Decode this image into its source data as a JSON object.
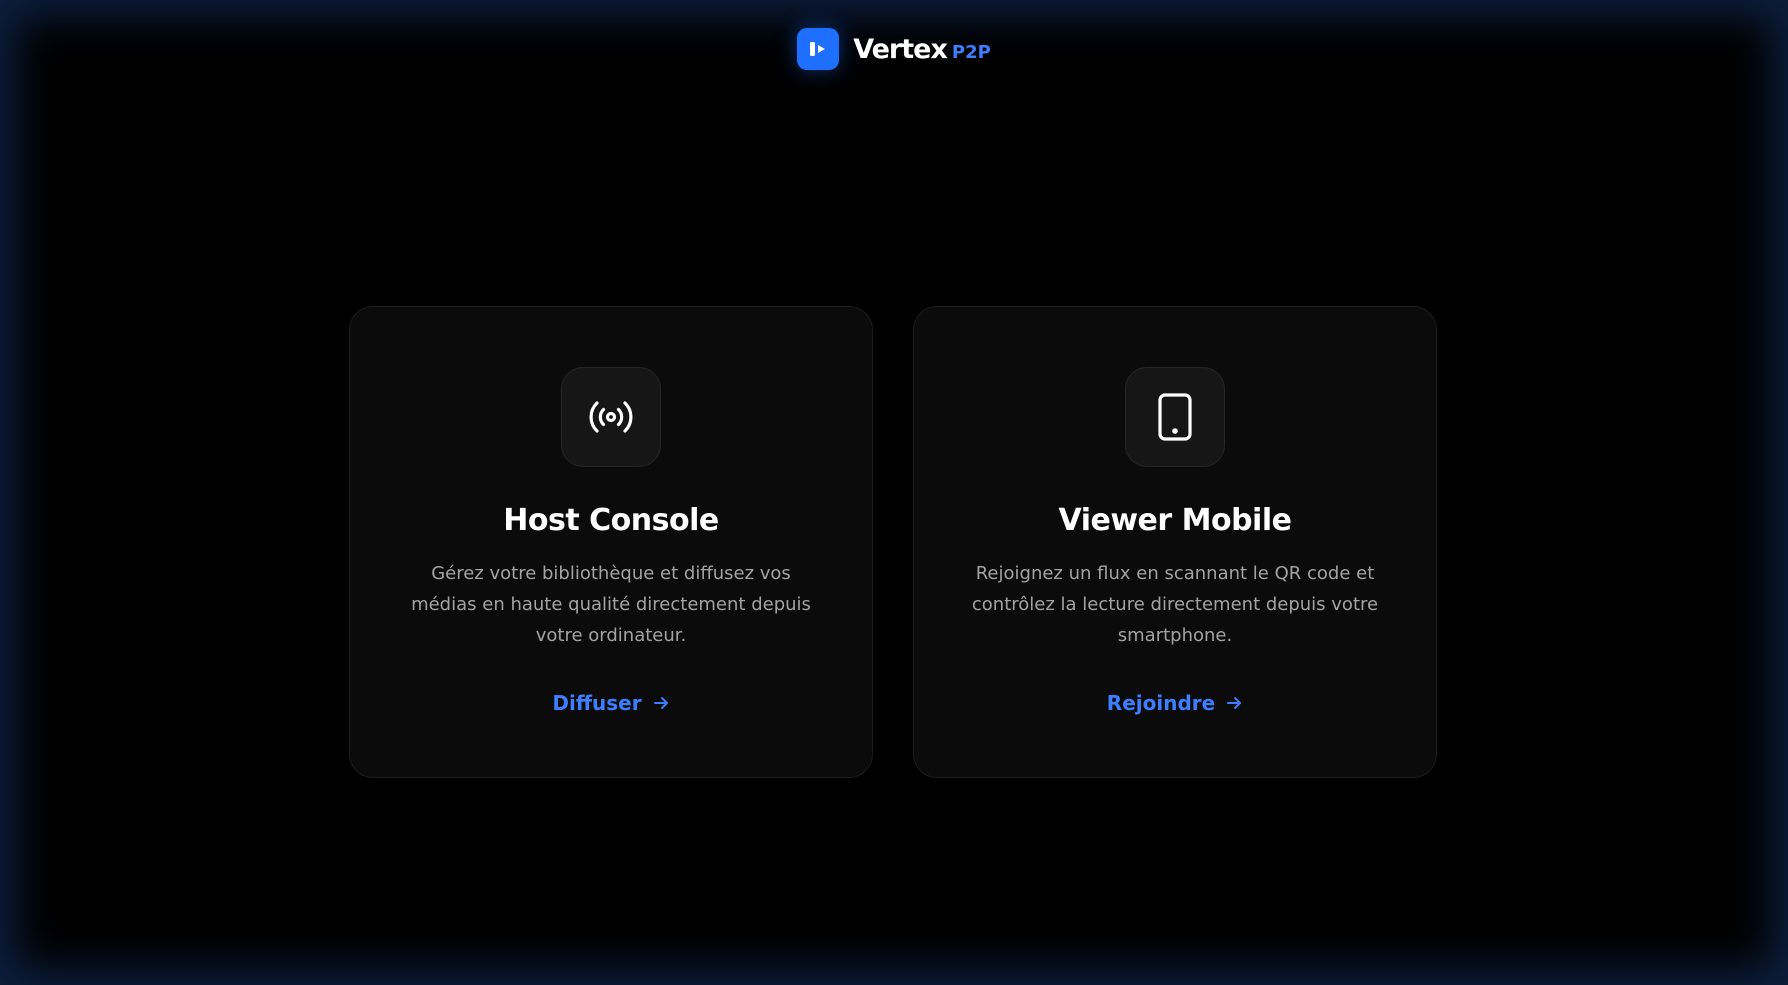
{
  "header": {
    "brand": "Vertex",
    "brand_suffix": "P2P",
    "logo_icon": "play-icon"
  },
  "cards": [
    {
      "icon": "broadcast-icon",
      "title": "Host Console",
      "description": "Gérez votre bibliothèque et diffusez vos médias en haute qualité directement depuis votre ordinateur.",
      "action_label": "Diffuser",
      "action_icon": "arrow-right-icon"
    },
    {
      "icon": "smartphone-icon",
      "title": "Viewer Mobile",
      "description": "Rejoignez un flux en scannant le QR code et contrôlez la lecture directement depuis votre smartphone.",
      "action_label": "Rejoindre",
      "action_icon": "arrow-right-icon"
    }
  ],
  "colors": {
    "accent": "#1f6fff",
    "link": "#3d7dff",
    "background": "#000000",
    "card": "#0b0b0b"
  }
}
